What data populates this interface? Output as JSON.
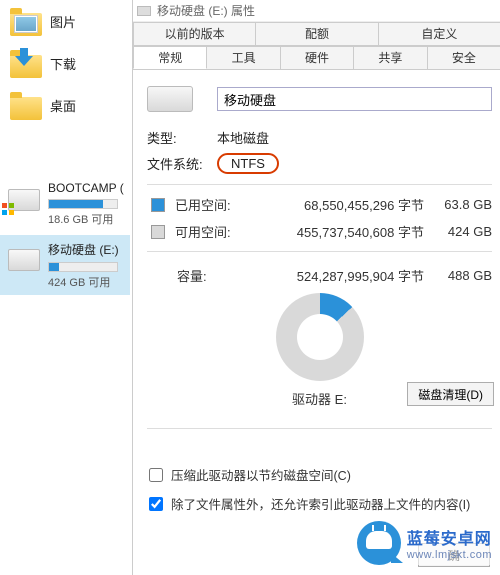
{
  "sidebar": {
    "quick": [
      {
        "label": "图片"
      },
      {
        "label": "下载"
      },
      {
        "label": "桌面"
      }
    ],
    "drives": [
      {
        "name": "BOOTCAMP (",
        "free_text": "18.6 GB 可用",
        "fill_pct": 80,
        "selected": false,
        "windows": true
      },
      {
        "name": "移动硬盘 (E:)",
        "free_text": "424 GB 可用",
        "fill_pct": 14,
        "selected": true,
        "windows": false
      }
    ]
  },
  "dialog": {
    "title": "移动硬盘 (E:) 属性",
    "tabs_top": [
      "以前的版本",
      "配额",
      "自定义"
    ],
    "tabs_bottom": [
      "常规",
      "工具",
      "硬件",
      "共享",
      "安全"
    ],
    "active_tab": "常规",
    "drive_name": "移动硬盘",
    "rows": {
      "type_label": "类型:",
      "type_value": "本地磁盘",
      "fs_label": "文件系统:",
      "fs_value": "NTFS"
    },
    "usage": {
      "used_label": "已用空间:",
      "used_bytes": "68,550,455,296 字节",
      "used_size": "63.8 GB",
      "free_label": "可用空间:",
      "free_bytes": "455,737,540,608 字节",
      "free_size": "424 GB",
      "cap_label": "容量:",
      "cap_bytes": "524,287,995,904 字节",
      "cap_size": "488 GB"
    },
    "drive_letter": "驱动器 E:",
    "cleanup_button": "磁盘清理(D)",
    "checkboxes": {
      "compress": {
        "label": "压缩此驱动器以节约磁盘空间(C)",
        "checked": false
      },
      "index": {
        "label": "除了文件属性外，还允许索引此驱动器上文件的内容(I)",
        "checked": true
      }
    },
    "ok_button": "确"
  },
  "brand": {
    "line1": "蓝莓安卓网",
    "line2": "www.lmjskt.com"
  }
}
